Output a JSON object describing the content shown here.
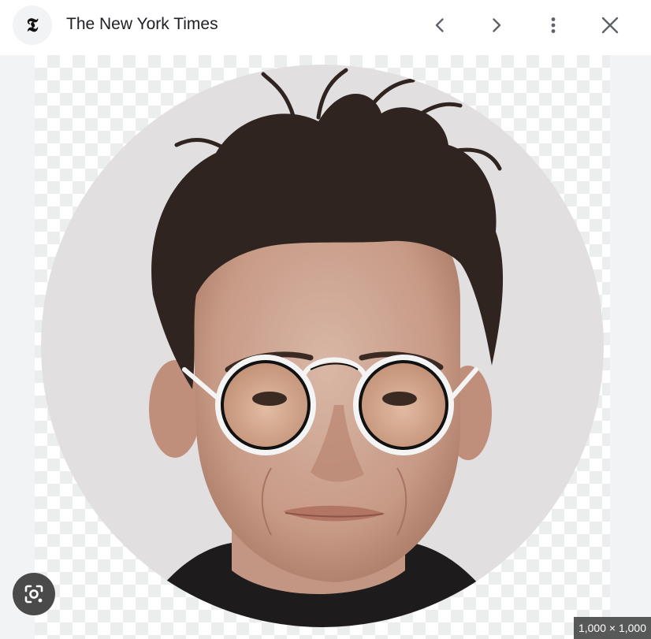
{
  "header": {
    "source_title": "The New York Times",
    "source_logo_glyph": "𝕿",
    "source_logo_icon": "nyt-logo-icon",
    "prev_icon": "chevron-left-icon",
    "next_icon": "chevron-right-icon",
    "more_icon": "more-vert-icon",
    "close_icon": "close-icon"
  },
  "image": {
    "subject": "circular-portrait-photo",
    "dimensions_label": "1,000 × 1,000",
    "lens_icon": "google-lens-icon"
  },
  "colors": {
    "header_bg": "#ffffff",
    "stage_bg": "#f1f3f4",
    "icon_color": "#5f6368",
    "title_color": "#202124"
  }
}
